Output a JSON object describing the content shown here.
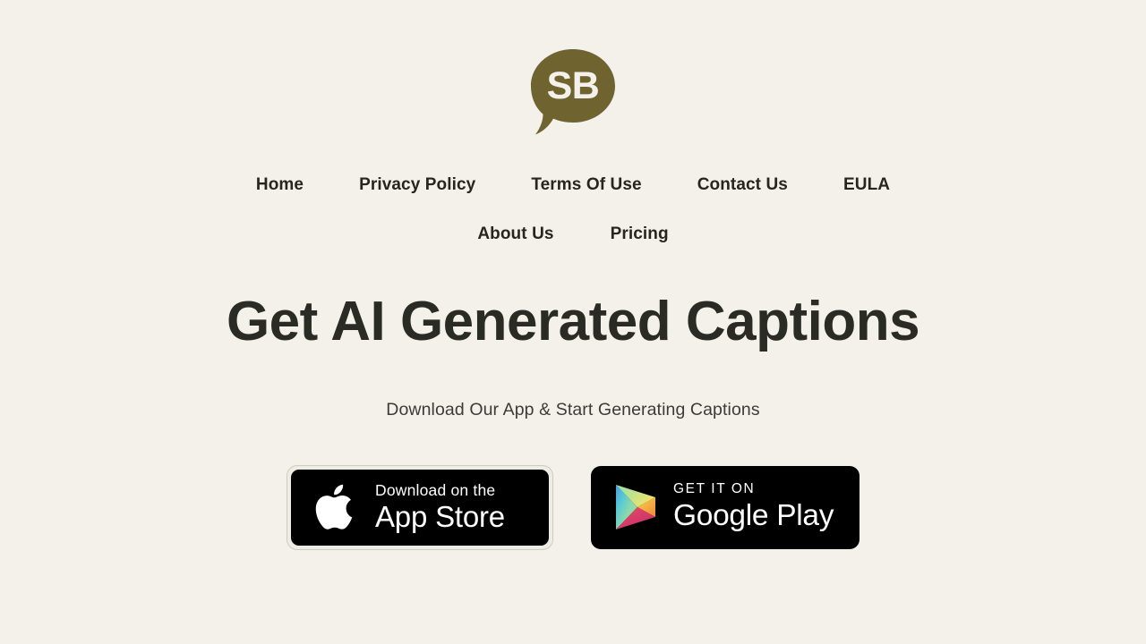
{
  "theme": {
    "background": "#f4f1ea",
    "logo_color": "#6f6330",
    "heading_color": "#2b2b26",
    "nav_color": "#26251f",
    "subtitle_color": "#3b3b38",
    "badge_background": "#000000"
  },
  "logo": {
    "icon": "speech-bubble-icon",
    "text": "SB"
  },
  "nav": {
    "primary": [
      {
        "label": "Home"
      },
      {
        "label": "Privacy Policy"
      },
      {
        "label": "Terms Of Use"
      },
      {
        "label": "Contact Us"
      },
      {
        "label": "EULA"
      }
    ],
    "secondary": [
      {
        "label": "About Us"
      },
      {
        "label": "Pricing"
      }
    ]
  },
  "hero": {
    "title": "Get AI Generated Captions",
    "subtitle": "Download Our App & Start Generating Captions"
  },
  "badges": {
    "apple": {
      "icon": "apple-logo-icon",
      "small_label": "Download on the",
      "big_label": "App Store"
    },
    "google": {
      "icon": "google-play-triangle-icon",
      "small_label": "GET IT ON",
      "big_label": "Google Play"
    }
  }
}
